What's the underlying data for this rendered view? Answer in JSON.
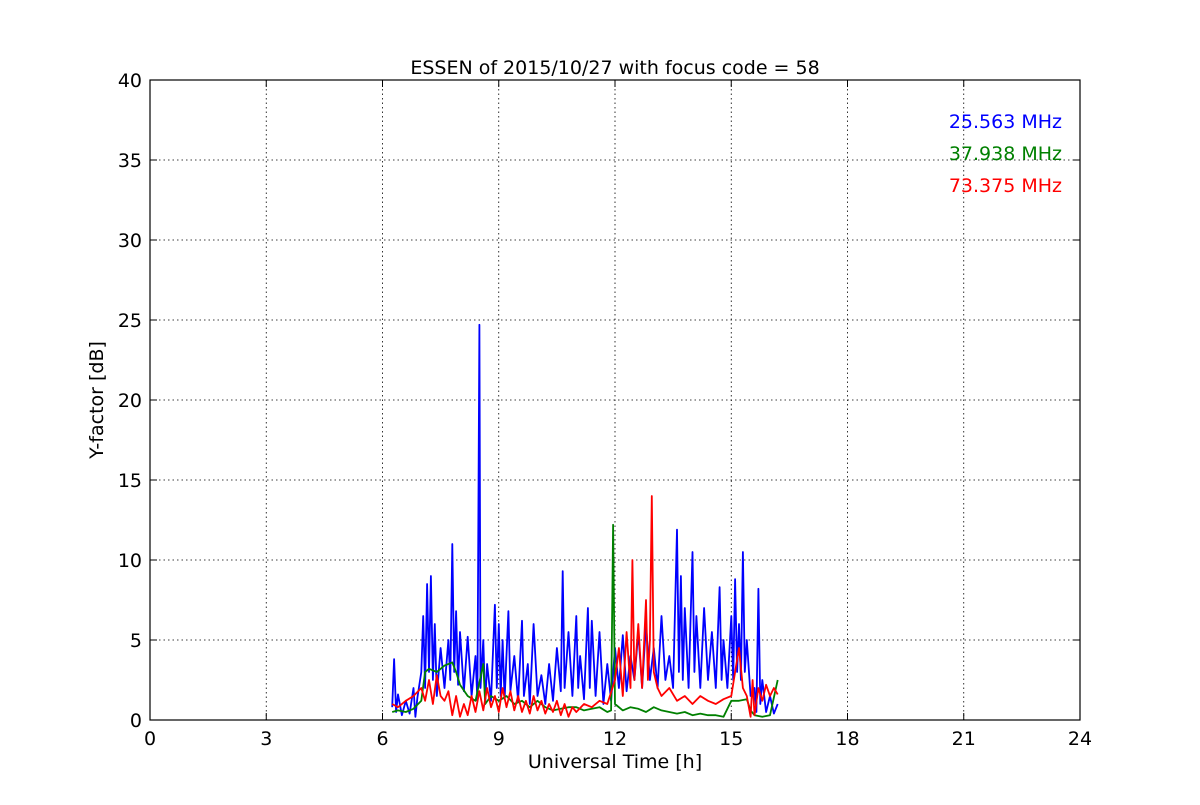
{
  "chart_data": {
    "type": "line",
    "title": "ESSEN of 2015/10/27 with focus code = 58",
    "xlabel": "Universal Time [h]",
    "ylabel": "Y-factor [dB]",
    "xlim": [
      0,
      24
    ],
    "ylim": [
      0,
      40
    ],
    "xticks": [
      0,
      3,
      6,
      9,
      12,
      15,
      18,
      21,
      24
    ],
    "yticks": [
      0,
      5,
      10,
      15,
      20,
      25,
      30,
      35,
      40
    ],
    "grid": true,
    "legend_position": "top-right",
    "series": [
      {
        "name": "25.563 MHz",
        "color": "#0000ff",
        "points": [
          [
            6.25,
            0.8
          ],
          [
            6.3,
            3.8
          ],
          [
            6.35,
            0.5
          ],
          [
            6.4,
            1.6
          ],
          [
            6.5,
            0.3
          ],
          [
            6.6,
            1.2
          ],
          [
            6.7,
            0.4
          ],
          [
            6.8,
            2.0
          ],
          [
            6.85,
            0.2
          ],
          [
            6.9,
            1.4
          ],
          [
            7.0,
            3.0
          ],
          [
            7.05,
            6.5
          ],
          [
            7.1,
            2.0
          ],
          [
            7.15,
            8.5
          ],
          [
            7.2,
            3.0
          ],
          [
            7.25,
            9.0
          ],
          [
            7.3,
            2.5
          ],
          [
            7.35,
            6.0
          ],
          [
            7.4,
            1.5
          ],
          [
            7.5,
            4.5
          ],
          [
            7.6,
            2.0
          ],
          [
            7.7,
            5.0
          ],
          [
            7.75,
            2.5
          ],
          [
            7.8,
            11.0
          ],
          [
            7.85,
            3.0
          ],
          [
            7.9,
            6.8
          ],
          [
            7.95,
            2.2
          ],
          [
            8.0,
            5.5
          ],
          [
            8.1,
            1.8
          ],
          [
            8.2,
            5.2
          ],
          [
            8.3,
            1.5
          ],
          [
            8.4,
            4.0
          ],
          [
            8.45,
            1.2
          ],
          [
            8.5,
            24.7
          ],
          [
            8.53,
            2.0
          ],
          [
            8.6,
            5.0
          ],
          [
            8.65,
            1.0
          ],
          [
            8.7,
            3.5
          ],
          [
            8.8,
            1.2
          ],
          [
            8.9,
            7.2
          ],
          [
            8.95,
            2.0
          ],
          [
            9.0,
            6.0
          ],
          [
            9.05,
            1.5
          ],
          [
            9.1,
            5.0
          ],
          [
            9.15,
            1.3
          ],
          [
            9.25,
            6.8
          ],
          [
            9.3,
            1.8
          ],
          [
            9.4,
            4.0
          ],
          [
            9.5,
            1.2
          ],
          [
            9.6,
            6.2
          ],
          [
            9.65,
            1.5
          ],
          [
            9.75,
            3.5
          ],
          [
            9.8,
            1.0
          ],
          [
            9.9,
            6.0
          ],
          [
            10.0,
            1.5
          ],
          [
            10.1,
            2.8
          ],
          [
            10.2,
            1.0
          ],
          [
            10.3,
            3.5
          ],
          [
            10.4,
            1.2
          ],
          [
            10.5,
            4.5
          ],
          [
            10.6,
            1.8
          ],
          [
            10.65,
            9.3
          ],
          [
            10.7,
            2.0
          ],
          [
            10.8,
            5.5
          ],
          [
            10.9,
            1.5
          ],
          [
            11.0,
            6.5
          ],
          [
            11.05,
            2.0
          ],
          [
            11.1,
            4.0
          ],
          [
            11.2,
            1.3
          ],
          [
            11.3,
            7.0
          ],
          [
            11.35,
            2.0
          ],
          [
            11.4,
            6.2
          ],
          [
            11.5,
            1.5
          ],
          [
            11.6,
            5.5
          ],
          [
            11.7,
            1.0
          ],
          [
            11.8,
            3.5
          ],
          [
            11.9,
            1.2
          ],
          [
            12.0,
            4.5
          ],
          [
            12.1,
            2.0
          ],
          [
            12.2,
            5.3
          ],
          [
            12.3,
            1.8
          ],
          [
            12.4,
            4.0
          ],
          [
            12.5,
            2.5
          ],
          [
            12.6,
            5.5
          ],
          [
            12.7,
            2.0
          ],
          [
            12.8,
            6.0
          ],
          [
            12.9,
            2.5
          ],
          [
            13.0,
            4.5
          ],
          [
            13.1,
            2.0
          ],
          [
            13.2,
            6.5
          ],
          [
            13.3,
            2.5
          ],
          [
            13.4,
            4.0
          ],
          [
            13.5,
            2.0
          ],
          [
            13.6,
            11.9
          ],
          [
            13.65,
            3.0
          ],
          [
            13.7,
            9.0
          ],
          [
            13.75,
            2.5
          ],
          [
            13.8,
            7.0
          ],
          [
            13.9,
            2.0
          ],
          [
            14.0,
            10.5
          ],
          [
            14.05,
            3.0
          ],
          [
            14.1,
            6.5
          ],
          [
            14.2,
            2.0
          ],
          [
            14.3,
            7.0
          ],
          [
            14.4,
            2.5
          ],
          [
            14.5,
            5.5
          ],
          [
            14.6,
            2.0
          ],
          [
            14.7,
            8.3
          ],
          [
            14.75,
            2.5
          ],
          [
            14.8,
            5.0
          ],
          [
            14.9,
            2.0
          ],
          [
            15.0,
            6.5
          ],
          [
            15.05,
            2.5
          ],
          [
            15.1,
            8.8
          ],
          [
            15.15,
            3.0
          ],
          [
            15.2,
            6.0
          ],
          [
            15.25,
            2.5
          ],
          [
            15.3,
            10.5
          ],
          [
            15.35,
            3.0
          ],
          [
            15.4,
            5.0
          ],
          [
            15.5,
            1.5
          ],
          [
            15.6,
            2.0
          ],
          [
            15.65,
            0.5
          ],
          [
            15.7,
            8.2
          ],
          [
            15.75,
            1.0
          ],
          [
            15.8,
            2.5
          ],
          [
            15.9,
            0.5
          ],
          [
            16.0,
            1.5
          ],
          [
            16.1,
            0.4
          ],
          [
            16.2,
            1.0
          ]
        ]
      },
      {
        "name": "37.938 MHz",
        "color": "#008000",
        "points": [
          [
            6.25,
            0.5
          ],
          [
            6.4,
            0.6
          ],
          [
            6.6,
            0.5
          ],
          [
            6.8,
            0.7
          ],
          [
            7.0,
            1.2
          ],
          [
            7.1,
            3.0
          ],
          [
            7.2,
            3.2
          ],
          [
            7.4,
            3.0
          ],
          [
            7.6,
            3.4
          ],
          [
            7.8,
            3.6
          ],
          [
            7.9,
            3.0
          ],
          [
            8.0,
            2.2
          ],
          [
            8.2,
            1.5
          ],
          [
            8.4,
            1.2
          ],
          [
            8.6,
            3.5
          ],
          [
            8.65,
            1.0
          ],
          [
            8.8,
            1.5
          ],
          [
            9.0,
            1.2
          ],
          [
            9.2,
            1.5
          ],
          [
            9.4,
            1.0
          ],
          [
            9.6,
            1.2
          ],
          [
            9.8,
            0.8
          ],
          [
            10.0,
            1.2
          ],
          [
            10.2,
            0.8
          ],
          [
            10.4,
            0.6
          ],
          [
            10.6,
            0.7
          ],
          [
            10.8,
            0.8
          ],
          [
            11.0,
            0.8
          ],
          [
            11.2,
            0.6
          ],
          [
            11.4,
            0.7
          ],
          [
            11.6,
            0.8
          ],
          [
            11.8,
            0.5
          ],
          [
            11.9,
            0.6
          ],
          [
            11.95,
            12.2
          ],
          [
            12.0,
            1.0
          ],
          [
            12.2,
            0.6
          ],
          [
            12.4,
            0.8
          ],
          [
            12.6,
            0.7
          ],
          [
            12.8,
            0.5
          ],
          [
            13.0,
            0.8
          ],
          [
            13.2,
            0.6
          ],
          [
            13.4,
            0.5
          ],
          [
            13.6,
            0.4
          ],
          [
            13.8,
            0.5
          ],
          [
            14.0,
            0.3
          ],
          [
            14.2,
            0.4
          ],
          [
            14.4,
            0.3
          ],
          [
            14.6,
            0.3
          ],
          [
            14.8,
            0.2
          ],
          [
            15.0,
            1.2
          ],
          [
            15.2,
            1.2
          ],
          [
            15.4,
            1.3
          ],
          [
            15.5,
            0.6
          ],
          [
            15.6,
            0.3
          ],
          [
            15.8,
            0.2
          ],
          [
            16.0,
            0.3
          ],
          [
            16.2,
            2.5
          ]
        ]
      },
      {
        "name": "73.375 MHz",
        "color": "#ff0000",
        "points": [
          [
            6.25,
            1.0
          ],
          [
            6.4,
            0.8
          ],
          [
            6.6,
            1.2
          ],
          [
            6.8,
            1.5
          ],
          [
            7.0,
            2.0
          ],
          [
            7.1,
            1.2
          ],
          [
            7.2,
            2.5
          ],
          [
            7.3,
            1.0
          ],
          [
            7.4,
            2.8
          ],
          [
            7.5,
            1.5
          ],
          [
            7.6,
            1.2
          ],
          [
            7.7,
            1.8
          ],
          [
            7.8,
            0.3
          ],
          [
            7.9,
            1.5
          ],
          [
            8.0,
            0.2
          ],
          [
            8.1,
            1.0
          ],
          [
            8.2,
            0.3
          ],
          [
            8.3,
            1.5
          ],
          [
            8.4,
            0.5
          ],
          [
            8.5,
            1.8
          ],
          [
            8.6,
            0.6
          ],
          [
            8.7,
            2.0
          ],
          [
            8.8,
            0.8
          ],
          [
            8.9,
            1.5
          ],
          [
            9.0,
            0.5
          ],
          [
            9.1,
            2.0
          ],
          [
            9.2,
            0.8
          ],
          [
            9.3,
            1.8
          ],
          [
            9.4,
            0.6
          ],
          [
            9.5,
            1.5
          ],
          [
            9.6,
            0.5
          ],
          [
            9.7,
            1.2
          ],
          [
            9.8,
            0.4
          ],
          [
            9.9,
            1.5
          ],
          [
            10.0,
            0.6
          ],
          [
            10.1,
            1.2
          ],
          [
            10.2,
            0.4
          ],
          [
            10.3,
            1.0
          ],
          [
            10.4,
            0.5
          ],
          [
            10.5,
            1.2
          ],
          [
            10.6,
            0.3
          ],
          [
            10.7,
            1.0
          ],
          [
            10.8,
            0.2
          ],
          [
            10.9,
            0.8
          ],
          [
            11.0,
            0.5
          ],
          [
            11.2,
            1.0
          ],
          [
            11.4,
            0.8
          ],
          [
            11.6,
            1.2
          ],
          [
            11.8,
            1.0
          ],
          [
            12.0,
            2.5
          ],
          [
            12.1,
            4.5
          ],
          [
            12.2,
            1.5
          ],
          [
            12.3,
            5.5
          ],
          [
            12.4,
            2.0
          ],
          [
            12.45,
            10.0
          ],
          [
            12.5,
            2.5
          ],
          [
            12.6,
            6.0
          ],
          [
            12.7,
            2.0
          ],
          [
            12.8,
            7.5
          ],
          [
            12.85,
            2.5
          ],
          [
            12.9,
            5.0
          ],
          [
            12.95,
            14.0
          ],
          [
            13.0,
            3.0
          ],
          [
            13.1,
            2.0
          ],
          [
            13.2,
            1.5
          ],
          [
            13.4,
            2.0
          ],
          [
            13.6,
            1.2
          ],
          [
            13.8,
            1.5
          ],
          [
            14.0,
            1.0
          ],
          [
            14.2,
            1.5
          ],
          [
            14.4,
            1.2
          ],
          [
            14.6,
            1.0
          ],
          [
            14.8,
            1.3
          ],
          [
            15.0,
            1.5
          ],
          [
            15.1,
            3.0
          ],
          [
            15.2,
            4.5
          ],
          [
            15.3,
            2.0
          ],
          [
            15.4,
            1.5
          ],
          [
            15.5,
            0.2
          ],
          [
            15.55,
            2.5
          ],
          [
            15.6,
            0.3
          ],
          [
            15.7,
            2.0
          ],
          [
            15.8,
            1.2
          ],
          [
            15.9,
            2.2
          ],
          [
            16.0,
            1.5
          ],
          [
            16.1,
            2.0
          ],
          [
            16.2,
            1.6
          ]
        ]
      }
    ]
  }
}
